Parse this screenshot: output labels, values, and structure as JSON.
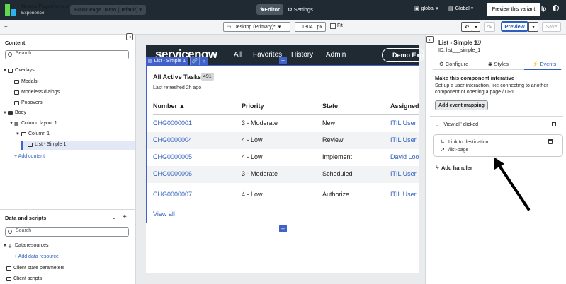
{
  "app": {
    "name": "Demo Experience",
    "subtitle": "Experience",
    "page_selector": "Blank Page Demo (Default) ▾",
    "editor_tab": "Editor",
    "settings_tab": "Settings",
    "scope_app": "global ▾",
    "scope_lang": "Global ▾",
    "tooltip": "Preview this variant",
    "help_short": "lp"
  },
  "toolbar": {
    "menu_glyph": "=",
    "device": "Desktop (Primary)*",
    "width_value": "1304",
    "width_unit": "px",
    "fit_label": "Fit",
    "preview_label": "Preview",
    "save_label": "Save"
  },
  "left": {
    "content_title": "Content",
    "search_placeholder": "Search",
    "tree": [
      {
        "label": "Overlays"
      },
      {
        "label": "Modals"
      },
      {
        "label": "Modeless dialogs"
      },
      {
        "label": "Popovers"
      },
      {
        "label": "Body"
      },
      {
        "label": "Column layout 1"
      },
      {
        "label": "Column 1"
      },
      {
        "label": "List - Simple 1"
      }
    ],
    "add_content": "+ Add content",
    "data_title": "Data and scripts",
    "data_search_placeholder": "Search",
    "data_tree": [
      {
        "label": "Data resources"
      },
      {
        "label": "+ Add data resource"
      },
      {
        "label": "Client state parameters"
      },
      {
        "label": "Client scripts"
      }
    ]
  },
  "canvas": {
    "logo": "servicenow",
    "nav": [
      "All",
      "Favorites",
      "History",
      "Admin"
    ],
    "demo_pill": "Demo Exp",
    "list_tag": "List - Simple 1",
    "list": {
      "title": "All Active Tasks",
      "count": "491",
      "refreshed": "Last refreshed 2h ago",
      "columns": [
        "Number ▲",
        "Priority",
        "State",
        "Assigned"
      ],
      "rows": [
        {
          "number": "CHG0000001",
          "priority": "3 - Moderate",
          "state": "New",
          "assigned": "ITIL User"
        },
        {
          "number": "CHG0000004",
          "priority": "4 - Low",
          "state": "Review",
          "assigned": "ITIL User"
        },
        {
          "number": "CHG0000005",
          "priority": "4 - Low",
          "state": "Implement",
          "assigned": "David Loo"
        },
        {
          "number": "CHG0000006",
          "priority": "3 - Moderate",
          "state": "Scheduled",
          "assigned": "ITIL User"
        },
        {
          "number": "CHG0000007",
          "priority": "4 - Low",
          "state": "Authorize",
          "assigned": "ITIL User"
        }
      ],
      "view_all": "View all"
    }
  },
  "right": {
    "title": "List - Simple 1",
    "id": "ID: list___simple_1",
    "tabs": [
      "Configure",
      "Styles",
      "Events"
    ],
    "active_tab": "Events",
    "events_heading": "Make this component interative",
    "events_desc": "Set up a user interaction, like connecting to another component or opening a page / URL.",
    "add_mapping": "Add event mapping",
    "event_name": "'View all' clicked",
    "handler_label": "Link to destination",
    "handler_url": "/list-page",
    "add_handler": "Add handler"
  },
  "colors": {
    "accent": "#4160c8",
    "link": "#2e5fbd",
    "topbar": "#1f2a33"
  }
}
